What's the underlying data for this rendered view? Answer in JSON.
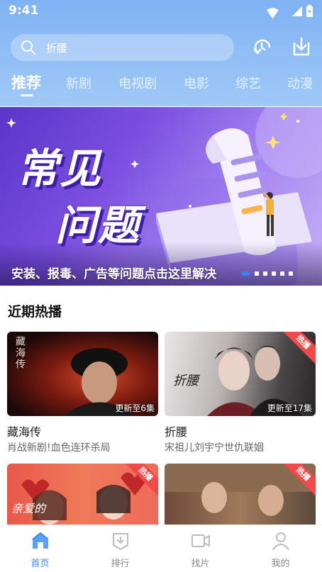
{
  "status_bar": {
    "time": "9:41"
  },
  "search": {
    "query": "折腰"
  },
  "tabs": [
    {
      "label": "推荐",
      "active": true
    },
    {
      "label": "新剧"
    },
    {
      "label": "电视剧"
    },
    {
      "label": "电影"
    },
    {
      "label": "综艺"
    },
    {
      "label": "动漫"
    }
  ],
  "banner": {
    "title_line1": "常见",
    "title_line2": "问题",
    "caption": "安装、报毒、广告等问题点击这里解决",
    "slide_count": 6,
    "active_slide": 1
  },
  "section": {
    "title": "近期热播"
  },
  "cards": [
    {
      "title": "藏海传",
      "subtitle": "肖战新剧!血色连环杀局",
      "episode": "更新至6集",
      "poster_text": "藏海传",
      "hot": false
    },
    {
      "title": "折腰",
      "subtitle": "宋祖儿刘宇宁世仇联姻",
      "episode": "更新至17集",
      "poster_text": "折腰",
      "hot": true,
      "hot_label": "热播"
    },
    {
      "title": "",
      "subtitle": "",
      "episode": "",
      "poster_text": "亲爱的",
      "hot": true,
      "hot_label": "热播"
    },
    {
      "title": "",
      "subtitle": "",
      "episode": "",
      "poster_text": "",
      "hot": true,
      "hot_label": "热播"
    }
  ],
  "bottom_nav": [
    {
      "label": "首页",
      "icon": "home-icon",
      "active": true
    },
    {
      "label": "排行",
      "icon": "ranking-icon"
    },
    {
      "label": "找片",
      "icon": "video-camera-icon"
    },
    {
      "label": "我的",
      "icon": "user-icon"
    }
  ],
  "colors": {
    "accent": "#3d86f5",
    "hot": "#f04a4a",
    "header": "#7fb2f3"
  }
}
